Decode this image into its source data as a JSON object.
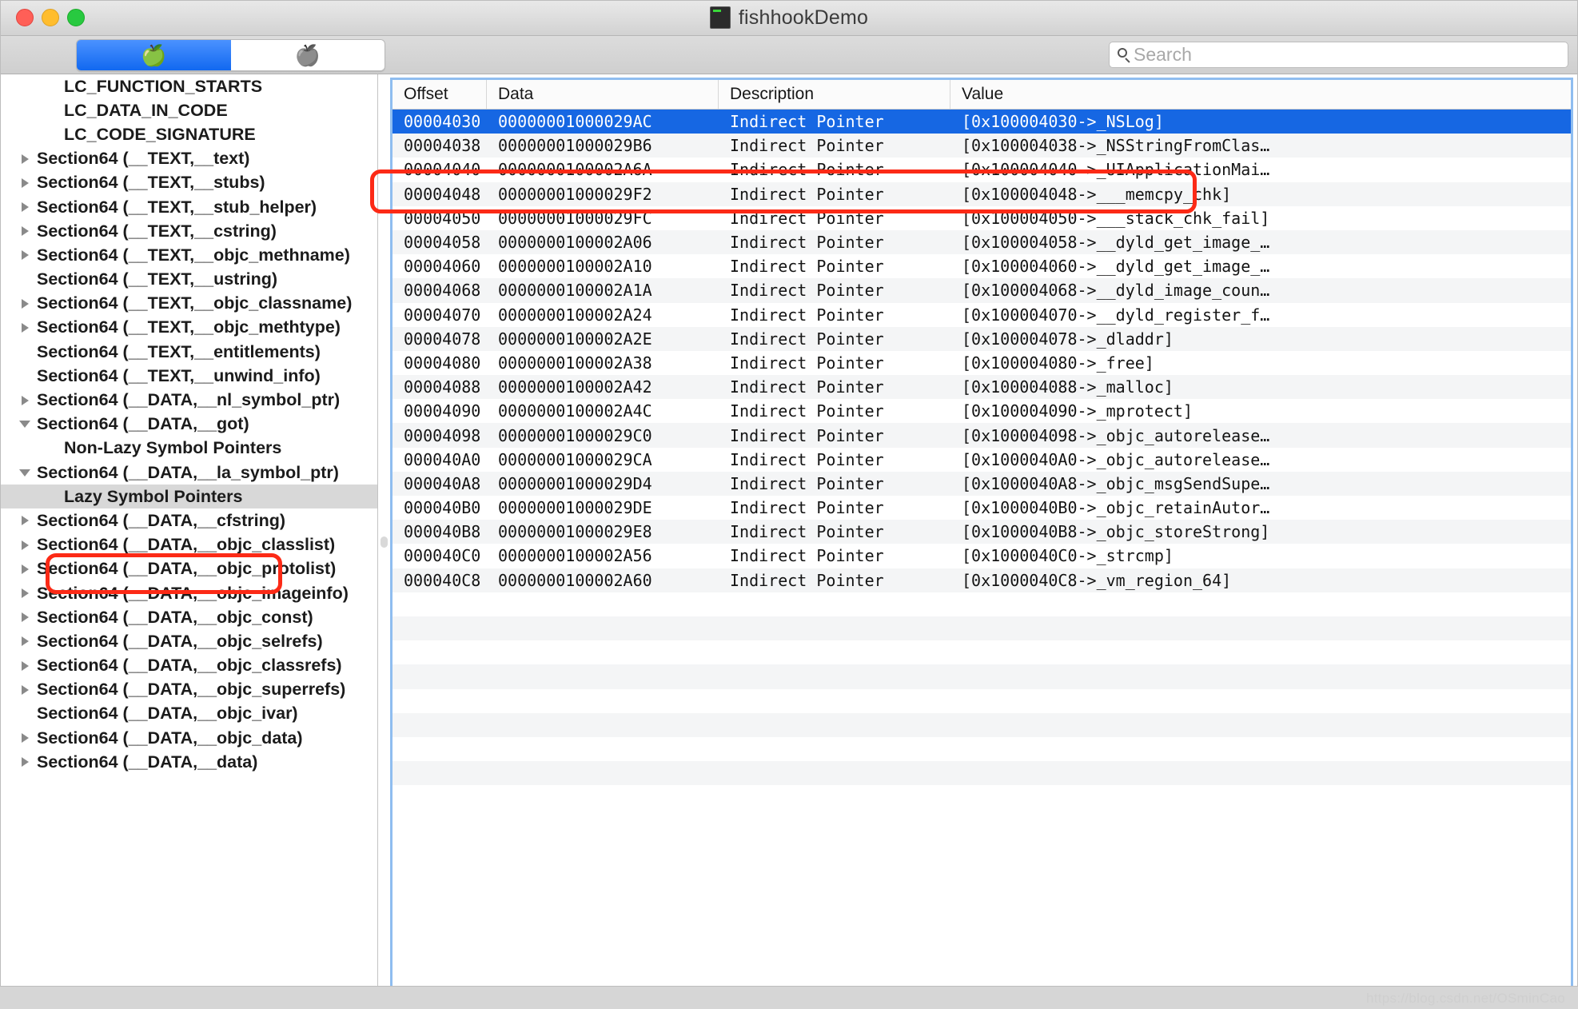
{
  "window": {
    "title": "fishhookDemo",
    "app_icon": "terminal-icon",
    "traffic_lights": [
      "close",
      "minimize",
      "zoom"
    ]
  },
  "toolbar": {
    "segments": [
      {
        "icon": "red-apple-icon",
        "selected": true
      },
      {
        "icon": "grey-apple-icon",
        "selected": false
      }
    ],
    "search": {
      "icon": "search-icon",
      "placeholder": "Search",
      "value": ""
    }
  },
  "sidebar": {
    "items": [
      {
        "label": "LC_FUNCTION_STARTS",
        "indent": 1,
        "twisty": "none"
      },
      {
        "label": "LC_DATA_IN_CODE",
        "indent": 1,
        "twisty": "none"
      },
      {
        "label": "LC_CODE_SIGNATURE",
        "indent": 1,
        "twisty": "none"
      },
      {
        "label": "Section64 (__TEXT,__text)",
        "indent": 0,
        "twisty": "closed"
      },
      {
        "label": "Section64 (__TEXT,__stubs)",
        "indent": 0,
        "twisty": "closed"
      },
      {
        "label": "Section64 (__TEXT,__stub_helper)",
        "indent": 0,
        "twisty": "closed"
      },
      {
        "label": "Section64 (__TEXT,__cstring)",
        "indent": 0,
        "twisty": "closed"
      },
      {
        "label": "Section64 (__TEXT,__objc_methname)",
        "indent": 0,
        "twisty": "closed"
      },
      {
        "label": "Section64 (__TEXT,__ustring)",
        "indent": 0,
        "twisty": "none"
      },
      {
        "label": "Section64 (__TEXT,__objc_classname)",
        "indent": 0,
        "twisty": "closed"
      },
      {
        "label": "Section64 (__TEXT,__objc_methtype)",
        "indent": 0,
        "twisty": "closed"
      },
      {
        "label": "Section64 (__TEXT,__entitlements)",
        "indent": 0,
        "twisty": "none"
      },
      {
        "label": "Section64 (__TEXT,__unwind_info)",
        "indent": 0,
        "twisty": "none"
      },
      {
        "label": "Section64 (__DATA,__nl_symbol_ptr)",
        "indent": 0,
        "twisty": "closed"
      },
      {
        "label": "Section64 (__DATA,__got)",
        "indent": 0,
        "twisty": "open"
      },
      {
        "label": "Non-Lazy Symbol Pointers",
        "indent": 1,
        "twisty": "none"
      },
      {
        "label": "Section64 (__DATA,__la_symbol_ptr)",
        "indent": 0,
        "twisty": "open"
      },
      {
        "label": "Lazy Symbol Pointers",
        "indent": 1,
        "twisty": "none",
        "selected": true
      },
      {
        "label": "Section64 (__DATA,__cfstring)",
        "indent": 0,
        "twisty": "closed"
      },
      {
        "label": "Section64 (__DATA,__objc_classlist)",
        "indent": 0,
        "twisty": "closed"
      },
      {
        "label": "Section64 (__DATA,__objc_protolist)",
        "indent": 0,
        "twisty": "closed"
      },
      {
        "label": "Section64 (__DATA,__objc_imageinfo)",
        "indent": 0,
        "twisty": "closed"
      },
      {
        "label": "Section64 (__DATA,__objc_const)",
        "indent": 0,
        "twisty": "closed"
      },
      {
        "label": "Section64 (__DATA,__objc_selrefs)",
        "indent": 0,
        "twisty": "closed"
      },
      {
        "label": "Section64 (__DATA,__objc_classrefs)",
        "indent": 0,
        "twisty": "closed"
      },
      {
        "label": "Section64 (__DATA,__objc_superrefs)",
        "indent": 0,
        "twisty": "closed"
      },
      {
        "label": "Section64 (__DATA,__objc_ivar)",
        "indent": 0,
        "twisty": "none"
      },
      {
        "label": "Section64 (__DATA,__objc_data)",
        "indent": 0,
        "twisty": "closed"
      },
      {
        "label": "Section64 (__DATA,__data)",
        "indent": 0,
        "twisty": "closed"
      }
    ]
  },
  "table": {
    "columns": [
      "Offset",
      "Data",
      "Description",
      "Value"
    ],
    "rows": [
      {
        "offset": "00004030",
        "data": "00000001000029AC",
        "description": "Indirect Pointer",
        "value": "[0x100004030->_NSLog]",
        "selected": true
      },
      {
        "offset": "00004038",
        "data": "00000001000029B6",
        "description": "Indirect Pointer",
        "value": "[0x100004038->_NSStringFromClas…"
      },
      {
        "offset": "00004040",
        "data": "0000000100002A6A",
        "description": "Indirect Pointer",
        "value": "[0x100004040->_UIApplicationMai…"
      },
      {
        "offset": "00004048",
        "data": "00000001000029F2",
        "description": "Indirect Pointer",
        "value": "[0x100004048->___memcpy_chk]"
      },
      {
        "offset": "00004050",
        "data": "00000001000029FC",
        "description": "Indirect Pointer",
        "value": "[0x100004050->___stack_chk_fail]"
      },
      {
        "offset": "00004058",
        "data": "0000000100002A06",
        "description": "Indirect Pointer",
        "value": "[0x100004058->__dyld_get_image_…"
      },
      {
        "offset": "00004060",
        "data": "0000000100002A10",
        "description": "Indirect Pointer",
        "value": "[0x100004060->__dyld_get_image_…"
      },
      {
        "offset": "00004068",
        "data": "0000000100002A1A",
        "description": "Indirect Pointer",
        "value": "[0x100004068->__dyld_image_coun…"
      },
      {
        "offset": "00004070",
        "data": "0000000100002A24",
        "description": "Indirect Pointer",
        "value": "[0x100004070->__dyld_register_f…"
      },
      {
        "offset": "00004078",
        "data": "0000000100002A2E",
        "description": "Indirect Pointer",
        "value": "[0x100004078->_dladdr]"
      },
      {
        "offset": "00004080",
        "data": "0000000100002A38",
        "description": "Indirect Pointer",
        "value": "[0x100004080->_free]"
      },
      {
        "offset": "00004088",
        "data": "0000000100002A42",
        "description": "Indirect Pointer",
        "value": "[0x100004088->_malloc]"
      },
      {
        "offset": "00004090",
        "data": "0000000100002A4C",
        "description": "Indirect Pointer",
        "value": "[0x100004090->_mprotect]"
      },
      {
        "offset": "00004098",
        "data": "00000001000029C0",
        "description": "Indirect Pointer",
        "value": "[0x100004098->_objc_autorelease…"
      },
      {
        "offset": "000040A0",
        "data": "00000001000029CA",
        "description": "Indirect Pointer",
        "value": "[0x1000040A0->_objc_autorelease…"
      },
      {
        "offset": "000040A8",
        "data": "00000001000029D4",
        "description": "Indirect Pointer",
        "value": "[0x1000040A8->_objc_msgSendSupe…"
      },
      {
        "offset": "000040B0",
        "data": "00000001000029DE",
        "description": "Indirect Pointer",
        "value": "[0x1000040B0->_objc_retainAutor…"
      },
      {
        "offset": "000040B8",
        "data": "00000001000029E8",
        "description": "Indirect Pointer",
        "value": "[0x1000040B8->_objc_storeStrong]"
      },
      {
        "offset": "000040C0",
        "data": "0000000100002A56",
        "description": "Indirect Pointer",
        "value": "[0x1000040C0->_strcmp]"
      },
      {
        "offset": "000040C8",
        "data": "0000000100002A60",
        "description": "Indirect Pointer",
        "value": "[0x1000040C8->_vm_region_64]"
      }
    ]
  },
  "annotations": {
    "accent_color": "#fc2a16",
    "selection_color": "#1667e3",
    "boxes": [
      {
        "name": "selected-table-row-highlight"
      },
      {
        "name": "lazy-symbol-pointers-highlight"
      }
    ]
  },
  "watermark": {
    "text": "https://blog.csdn.net/OSminCao"
  }
}
